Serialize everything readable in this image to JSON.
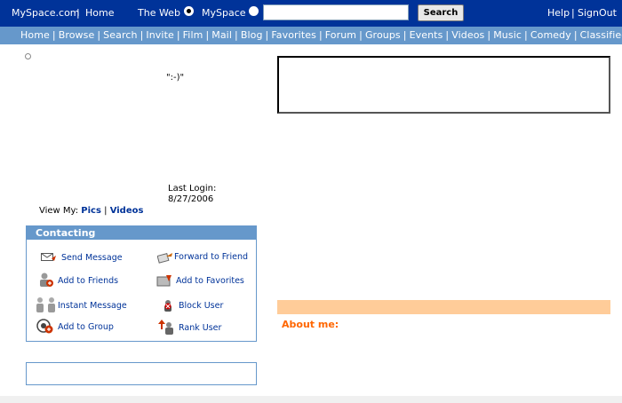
{
  "header": {
    "site": "MySpace.com",
    "home": "Home",
    "web_label": "The Web",
    "myspace_label": "MySpace",
    "search_value": "",
    "search_button": "Search",
    "help": "Help",
    "signout": "SignOut"
  },
  "nav": {
    "items": [
      "Home",
      "Browse",
      "Search",
      "Invite",
      "Film",
      "Mail",
      "Blog",
      "Favorites",
      "Forum",
      "Groups",
      "Events",
      "Videos",
      "Music",
      "Comedy",
      "Classifieds"
    ]
  },
  "profile": {
    "mood": "\":-)\"",
    "last_login_label": "Last Login:",
    "last_login_date": "8/27/2006",
    "view_my_label": "View My:",
    "pics": "Pics",
    "videos": "Videos"
  },
  "contacting": {
    "title": "Contacting",
    "send_message": "Send Message",
    "forward_to_friend": "Forward to Friend",
    "add_to_friends": "Add to Friends",
    "add_to_favorites": "Add to Favorites",
    "instant_message": "Instant Message",
    "block_user": "Block User",
    "add_to_group": "Add to Group",
    "rank_user": "Rank User"
  },
  "about": {
    "label": "About me:"
  },
  "colors": {
    "header_bg": "#003399",
    "nav_bg": "#6698cb",
    "about_bar": "#ffcc99",
    "about_text": "#ff6600"
  }
}
